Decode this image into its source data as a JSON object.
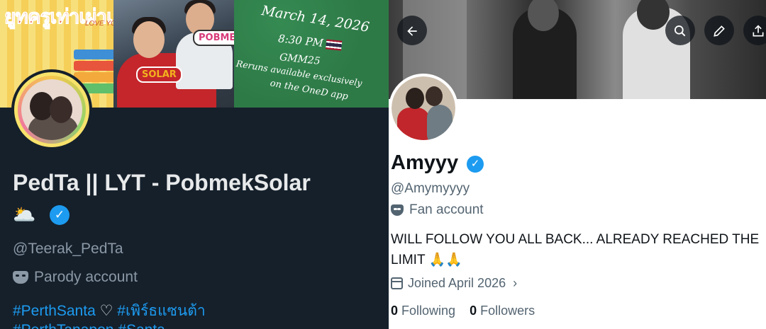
{
  "left_profile": {
    "banner": {
      "title_thai": "ยูทครูเท่าเผ่าเลย",
      "subtitle": "LOVE YOU TEACHER",
      "tag_solar": "SOLAR",
      "tag_pobmek": "POBMEK",
      "date": "March 14, 2026",
      "time": "8:30 PM",
      "channel": "GMM25",
      "reruns_line1": "Reruns available exclusively",
      "reruns_line2": "on the OneD app"
    },
    "display_name": "PedTa || LYT - PobmekSolar",
    "name_emoji": "🌥️",
    "handle": "@Teerak_PedTa",
    "account_type": "Parody account",
    "hashtags_line1": "#PerthSanta",
    "hashtags_heart": "♡",
    "hashtags_line1b": "#เพิร์ธแซนต้า",
    "hashtags_line2": "#PerthTanapon #Santa"
  },
  "right_profile": {
    "display_name": "Amyyy",
    "handle": "@Amymyyyy",
    "account_type": "Fan account",
    "bio": "WILL FOLLOW YOU ALL BACK... ALREADY REACHED THE LIMIT 🙏🙏",
    "joined": "Joined April 2026",
    "following_count": "0",
    "following_label": "Following",
    "followers_count": "0",
    "followers_label": "Followers"
  },
  "icons": {
    "back": "arrow-left-icon",
    "search": "search-icon",
    "edit": "pencil-icon",
    "share": "share-icon",
    "verified": "verified-badge-icon",
    "account_type": "mask-icon",
    "joined": "calendar-icon"
  },
  "colors": {
    "dark_bg": "#15202b",
    "link_blue": "#1d9bf0",
    "muted_dark": "#8b98a5",
    "muted_light": "#536471"
  }
}
